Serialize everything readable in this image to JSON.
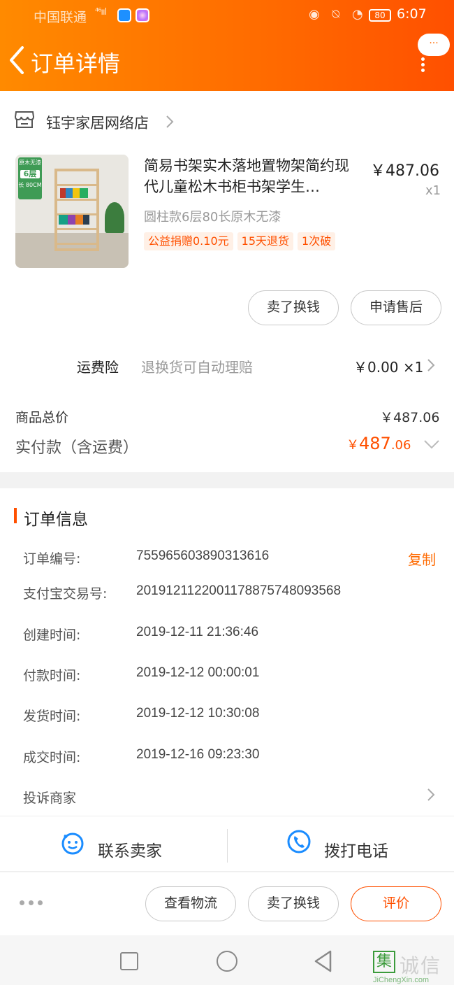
{
  "status_bar": {
    "carrier": "中国联通",
    "signal": "⁴⁶ııl",
    "battery": "80",
    "time": "6:07"
  },
  "header": {
    "title": "订单详情",
    "more_bubble": "···"
  },
  "shop": {
    "name": "钰宇家居网络店"
  },
  "product": {
    "thumb_tag_top": "原木无漆",
    "thumb_tag_layers": "6层",
    "thumb_tag_size": "长 80CM",
    "title": "简易书架实木落地置物架简约现代儿童松木书柜书架学生…",
    "price": "￥487.06",
    "quantity": "x1",
    "spec": "圆柱款6层80长原木无漆",
    "tags": [
      "公益捐赠0.10元",
      "15天退货",
      "1次破"
    ]
  },
  "item_buttons": {
    "sell": "卖了换钱",
    "after_sale": "申请售后"
  },
  "insurance": {
    "label": "运费险",
    "desc": "退换货可自动理赔",
    "price": "￥0.00 ×1"
  },
  "totals": {
    "subtotal_label": "商品总价",
    "subtotal_value": "￥487.06",
    "paid_label": "实付款（含运费）",
    "paid_symbol": "￥",
    "paid_integer": "487",
    "paid_decimal": ".06"
  },
  "order_info": {
    "title": "订单信息",
    "copy": "复制",
    "rows": [
      {
        "label": "订单编号:",
        "value": "755965603890313616"
      },
      {
        "label": "支付宝交易号:",
        "value": "2019121122001178875748093568"
      },
      {
        "label": "创建时间:",
        "value": "2019-12-11 21:36:46"
      },
      {
        "label": "付款时间:",
        "value": "2019-12-12 00:00:01"
      },
      {
        "label": "发货时间:",
        "value": "2019-12-12 10:30:08"
      },
      {
        "label": "成交时间:",
        "value": "2019-12-16 09:23:30"
      }
    ],
    "complain": "投诉商家"
  },
  "contact": {
    "seller": "联系卖家",
    "phone": "拨打电话"
  },
  "actions": {
    "logistics": "查看物流",
    "sell": "卖了换钱",
    "review": "评价"
  },
  "watermark": {
    "box": "集",
    "text": "诚信",
    "sub": "JiChengXin.com"
  },
  "colors": {
    "accent": "#ff5000",
    "header_start": "#ff8a00",
    "header_end": "#ff5000"
  }
}
